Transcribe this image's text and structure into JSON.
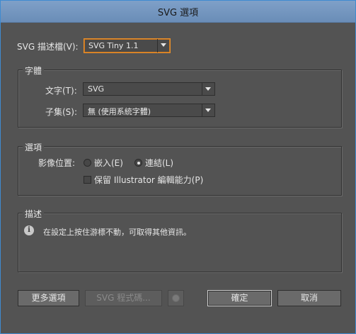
{
  "window": {
    "title": "SVG 選項"
  },
  "profile": {
    "label": "SVG 描述檔(V):",
    "value": "SVG Tiny 1.1"
  },
  "fonts": {
    "group_title": "字體",
    "type_label": "文字(T):",
    "type_value": "SVG",
    "subset_label": "子集(S):",
    "subset_value": "無 (使用系統字體)"
  },
  "options": {
    "group_title": "選項",
    "image_location_label": "影像位置:",
    "embed_label": "嵌入(E)",
    "link_label": "連結(L)",
    "image_location_selected": "link",
    "preserve_label": "保留 Illustrator 編輯能力(P)",
    "preserve_checked": false
  },
  "description": {
    "group_title": "描述",
    "text": "在設定上按住游標不動，可取得其他資訊。"
  },
  "buttons": {
    "more_options": "更多選項",
    "svg_code": "SVG 程式碼...",
    "ok": "確定",
    "cancel": "取消"
  },
  "colors": {
    "panel_bg": "#535353",
    "title_bar": "#6d8fb9",
    "focus_outline": "#e8902c"
  }
}
